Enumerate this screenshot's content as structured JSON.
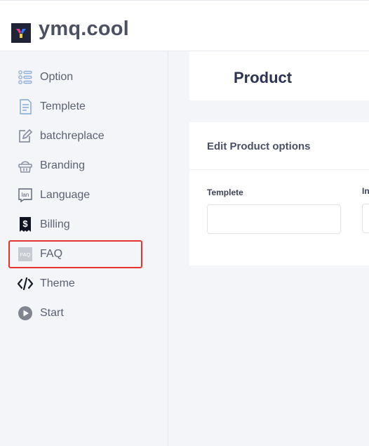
{
  "app": {
    "brand": "ymq.cool"
  },
  "sidebar": {
    "items": [
      {
        "label": "Option",
        "icon": "list-icon"
      },
      {
        "label": "Templete",
        "icon": "document-icon"
      },
      {
        "label": "batchreplace",
        "icon": "edit-icon"
      },
      {
        "label": "Branding",
        "icon": "basket-icon"
      },
      {
        "label": "Language",
        "icon": "language-icon",
        "icon_text": "lan"
      },
      {
        "label": "Billing",
        "icon": "dollar-icon",
        "icon_text": "$"
      },
      {
        "label": "FAQ",
        "icon": "faq-icon",
        "icon_text": "FAQ",
        "highlighted": true
      },
      {
        "label": "Theme",
        "icon": "code-icon"
      },
      {
        "label": "Start",
        "icon": "play-icon"
      }
    ]
  },
  "main": {
    "title": "Product",
    "options": {
      "title": "Edit Product options",
      "fields": [
        {
          "label": "Templete",
          "value": "",
          "placeholder": ""
        },
        {
          "label": "In",
          "value": "",
          "placeholder": ""
        }
      ]
    }
  },
  "colors": {
    "highlight": "#e3342f",
    "icon": "#8d93a5"
  }
}
